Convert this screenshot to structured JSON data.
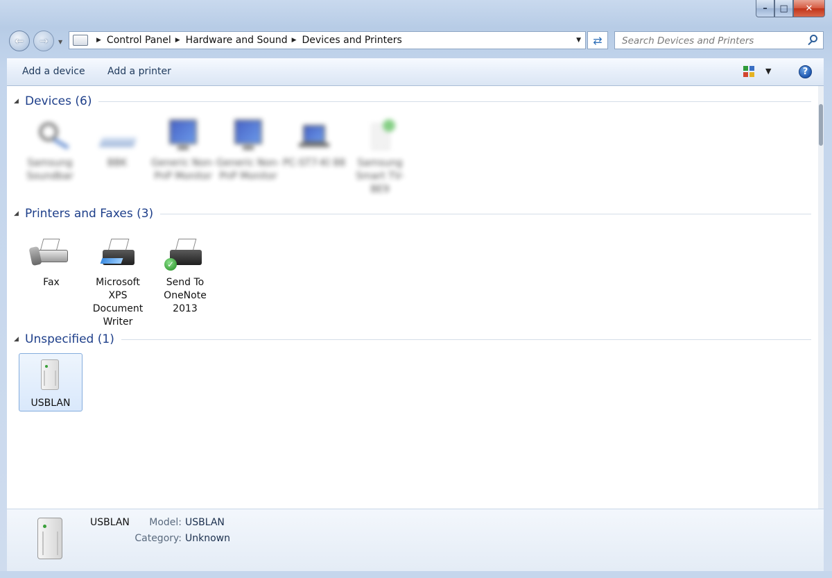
{
  "window": {
    "caption": {
      "minimize": "–",
      "maximize": "□",
      "close": "✕"
    }
  },
  "nav": {
    "back_glyph": "←",
    "forward_glyph": "→",
    "breadcrumbs": [
      "Control Panel",
      "Hardware and Sound",
      "Devices and Printers"
    ],
    "refresh_glyph": "⇄",
    "search_placeholder": "Search Devices and Printers"
  },
  "toolbar": {
    "add_device": "Add a device",
    "add_printer": "Add a printer",
    "help_glyph": "?"
  },
  "groups": {
    "devices": {
      "title": "Devices (6)",
      "items": [
        "Samsung Soundbar",
        "BBK",
        "Generic Non-PnP Monitor",
        "Generic Non-PnP Monitor",
        "PC-ST7-KI 88",
        "Samsung Smart TV-BE9"
      ]
    },
    "printers": {
      "title": "Printers and Faxes (3)",
      "items": [
        "Fax",
        "Microsoft XPS Document Writer",
        "Send To OneNote 2013"
      ]
    },
    "unspecified": {
      "title": "Unspecified (1)",
      "items": [
        "USBLAN"
      ]
    }
  },
  "details": {
    "name": "USBLAN",
    "model_label": "Model:",
    "model_value": "USBLAN",
    "category_label": "Category:",
    "category_value": "Unknown"
  },
  "colors": {
    "group_title": "#1e3f8a",
    "selection_border": "#84acdd",
    "close_button": "#c1351a"
  }
}
